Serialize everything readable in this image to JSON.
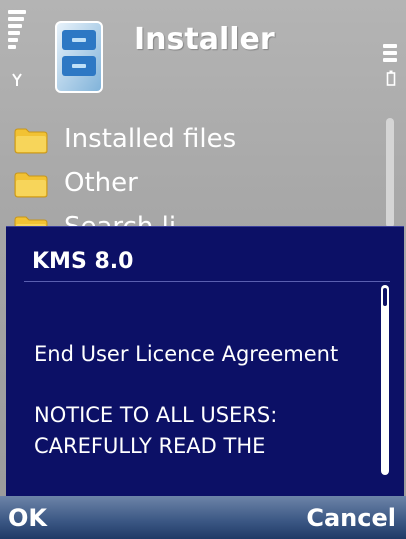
{
  "header": {
    "title": "Installer",
    "icons": [
      "signal-strength-icon",
      "antenna-icon",
      "installer-app-icon",
      "battery-icon"
    ]
  },
  "list": {
    "items": [
      {
        "label": "Installed files",
        "icon": "folder-icon"
      },
      {
        "label": "Other",
        "icon": "folder-icon"
      },
      {
        "label": "Search li...",
        "icon": "folder-icon"
      }
    ]
  },
  "dialog": {
    "title": "KMS 8.0",
    "body": [
      "End User Licence Agreement",
      "NOTICE TO ALL USERS: CAREFULLY READ THE"
    ]
  },
  "softkeys": {
    "left": "OK",
    "right": "Cancel"
  },
  "colors": {
    "dialog_bg": "#0c1066",
    "background": "#a7a7a7",
    "text": "#ffffff",
    "folder": "#f2c233"
  }
}
